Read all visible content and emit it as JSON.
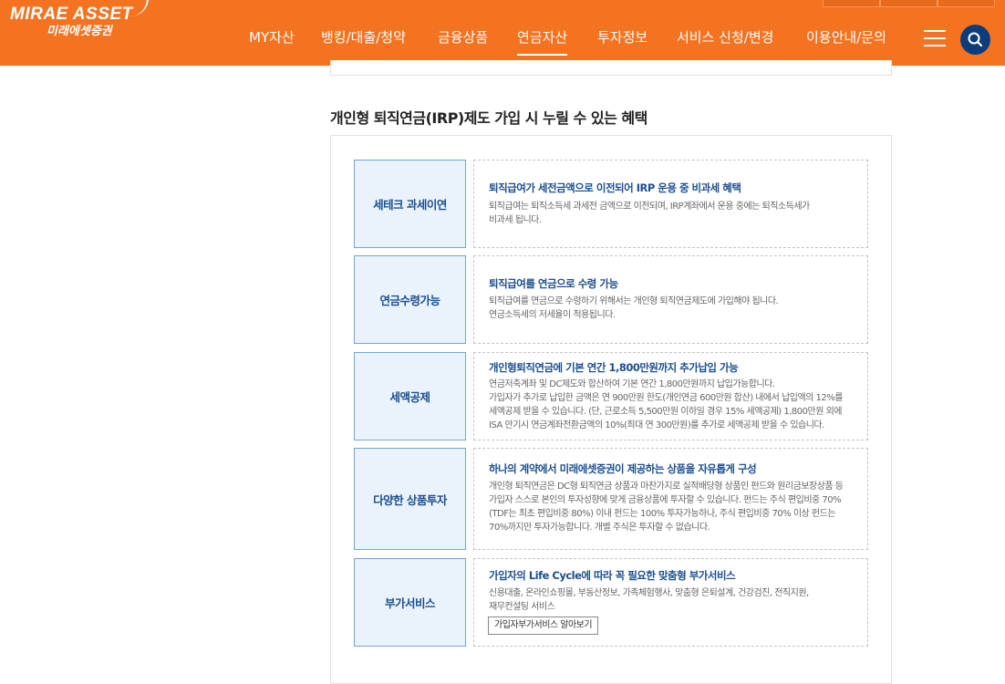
{
  "header": {
    "logo_main": "MIRAE ASSET",
    "logo_sub": "미래에셋증권",
    "nav": [
      "MY자산",
      "뱅킹/대출/청약",
      "금융상품",
      "연금자산",
      "투자정보",
      "서비스 신청/변경",
      "이용안내/문의"
    ],
    "active_nav": "연금자산",
    "menu_icon": "hamburger-menu-icon",
    "search_icon": "search-icon",
    "brand_color": "#f47321",
    "search_color": "#0e3c7a"
  },
  "section": {
    "title": "개인형 퇴직연금(IRP)제도 가입 시 누릴 수 있는 혜택"
  },
  "benefits": [
    {
      "label": "세테크 과세이연",
      "heading": "퇴직급여가 세전금액으로 이전되어 IRP 운용 중 비과세 혜택",
      "lines": [
        "퇴직급여는 퇴직소득세 과세전 금액으로 이전되며, IRP계좌에서 운용 중에는 퇴직소득세가",
        "비과세 됩니다."
      ]
    },
    {
      "label": "연금수령가능",
      "heading": "퇴직급여를 연금으로 수령 가능",
      "lines": [
        "퇴직급여를 연금으로 수령하기 위해서는 개인형 퇴직연금제도에 가입해야 됩니다.",
        "연금소득세의 저세율이 적용됩니다."
      ]
    },
    {
      "label": "세액공제",
      "heading": "개인형퇴직연금에 기본 연간 1,800만원까지 추가납입 가능",
      "lines": [
        "연금저축계좌 및 DC제도와 합산하여 기본 연간 1,800만원까지 납입가능합니다.",
        "가입자가 추가로 납입한 금액은 연 900만원 한도(개인연금 600만원 합산) 내에서 납입액의 12%를",
        "세액공제 받을 수 있습니다. (단, 근로소득 5,500만원 이하일 경우 15% 세액공제) 1,800만원 외에",
        "ISA 만기시 연금계좌전환금액의 10%(최대 연 300만원)를 추가로 세액공제 받을 수 있습니다."
      ]
    },
    {
      "label": "다양한 상품투자",
      "heading": "하나의 계약에서 미래에셋증권이 제공하는 상품을 자유롭게 구성",
      "lines": [
        "개인형 퇴직연금은 DC형 퇴직연금 상품과 마찬가지로 실적배당형 상품인 펀드와 원리금보장상품 등",
        "가입자 스스로 본인의 투자성향에 맞게 금융상품에 투자할 수 있습니다. 펀드는 주식 편입비중 70%",
        "(TDF는 최초 편입비중 80%) 이내 펀드는 100% 투자가능하나, 주식 편입비중 70% 이상 펀드는",
        "70%까지만 투자가능합니다. 개별 주식은 투자할 수 없습니다."
      ]
    },
    {
      "label": "부가서비스",
      "heading": "가입자의 Life Cycle에 따라 꼭 필요한 맞춤형 부가서비스",
      "lines": [
        "신용대출, 온라인쇼핑몰, 부동산정보, 가족체험행사, 맞춤형 은퇴설계, 건강검진, 전직지원,",
        "재무컨설팅 서비스"
      ],
      "button": "가입자부가서비스 알아보기"
    }
  ]
}
